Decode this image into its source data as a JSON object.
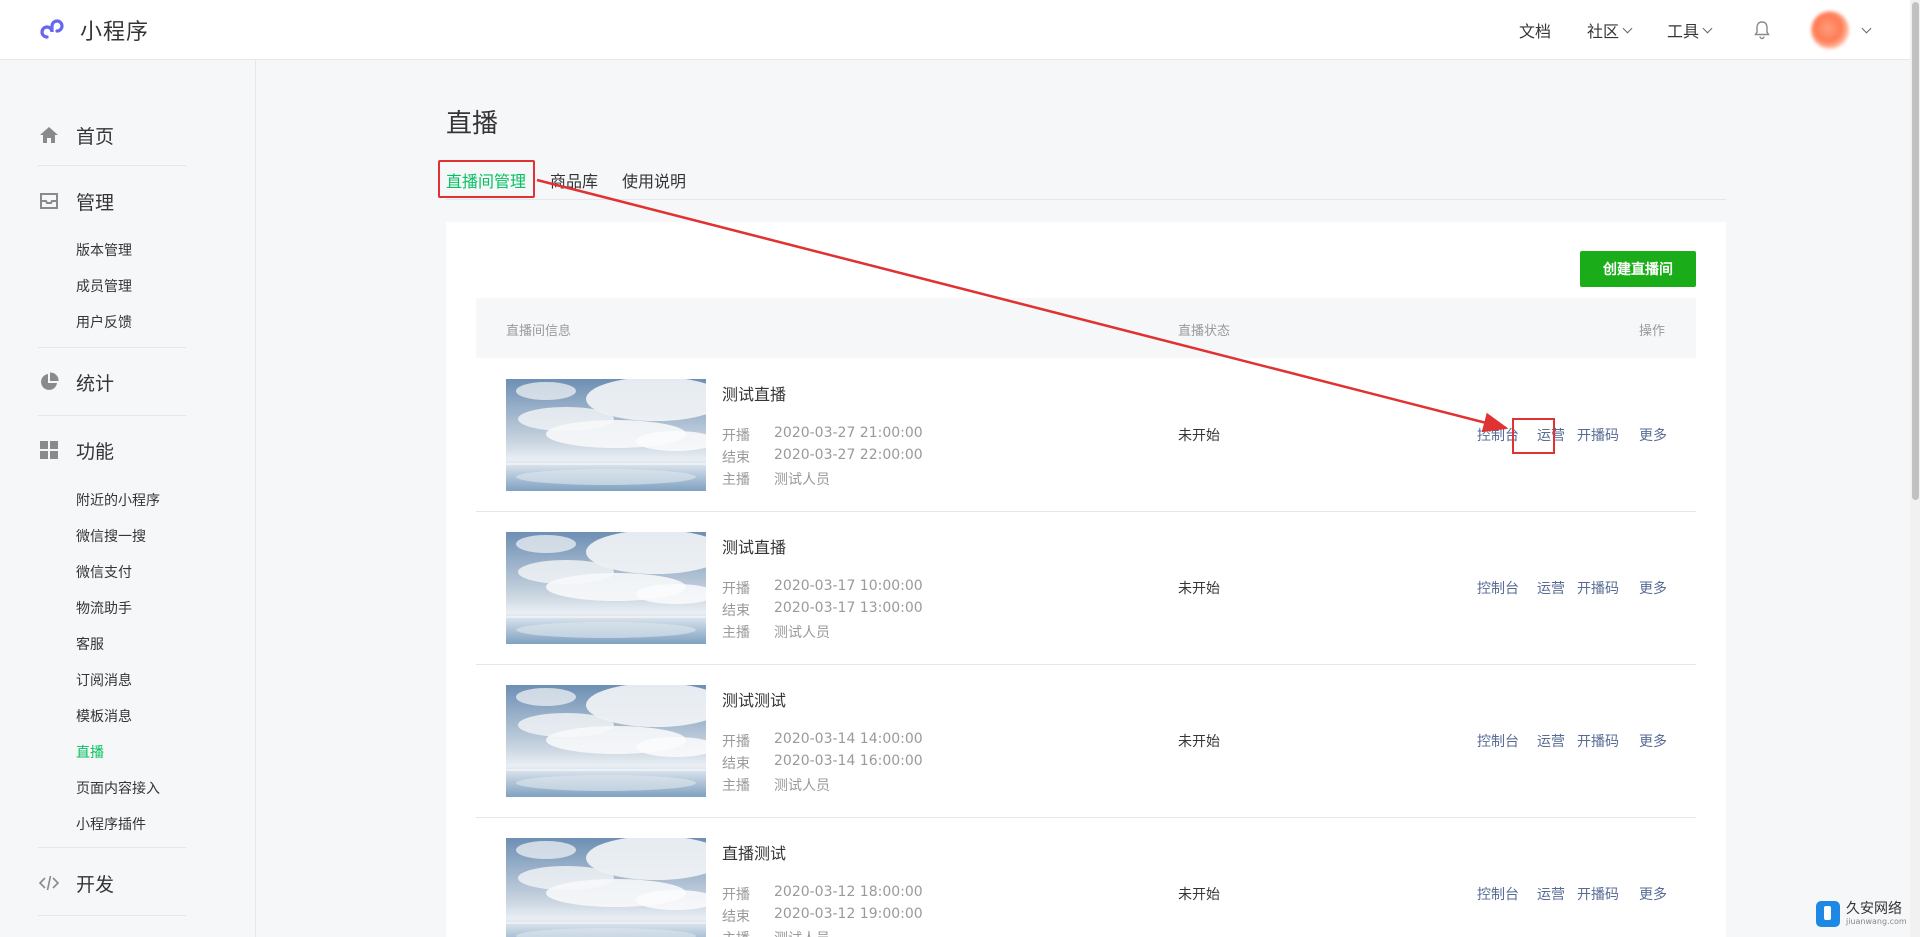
{
  "header": {
    "logo_text": "小程序",
    "nav": {
      "docs": "文档",
      "community": "社区",
      "tools": "工具"
    }
  },
  "sidebar": {
    "home": "首页",
    "manage": {
      "title": "管理",
      "items": [
        "版本管理",
        "成员管理",
        "用户反馈"
      ]
    },
    "stats": "统计",
    "features": {
      "title": "功能",
      "items": [
        "附近的小程序",
        "微信搜一搜",
        "微信支付",
        "物流助手",
        "客服",
        "订阅消息",
        "模板消息",
        "直播",
        "页面内容接入",
        "小程序插件"
      ],
      "active": "直播"
    },
    "develop": "开发"
  },
  "main": {
    "title": "直播",
    "tabs": [
      "直播间管理",
      "商品库",
      "使用说明"
    ],
    "active_tab": "直播间管理",
    "create_button": "创建直播间",
    "table_headers": {
      "info": "直播间信息",
      "status": "直播状态",
      "actions": "操作"
    },
    "meta_labels": {
      "start": "开播",
      "end": "结束",
      "anchor": "主播"
    },
    "action_labels": [
      "控制台",
      "运营",
      "开播码",
      "更多"
    ],
    "rooms": [
      {
        "title": "测试直播",
        "start": "2020-03-27 21:00:00",
        "end": "2020-03-27 22:00:00",
        "anchor": "测试人员",
        "status": "未开始"
      },
      {
        "title": "测试直播",
        "start": "2020-03-17 10:00:00",
        "end": "2020-03-17 13:00:00",
        "anchor": "测试人员",
        "status": "未开始"
      },
      {
        "title": "测试测试",
        "start": "2020-03-14 14:00:00",
        "end": "2020-03-14 16:00:00",
        "anchor": "测试人员",
        "status": "未开始"
      },
      {
        "title": "直播测试",
        "start": "2020-03-12 18:00:00",
        "end": "2020-03-12 19:00:00",
        "anchor": "测试人员",
        "status": "未开始"
      }
    ]
  },
  "watermark": {
    "main": "久安网络",
    "sub": "jiuanwang.com"
  },
  "colors": {
    "accent_green": "#07c160",
    "button_green": "#1aad19",
    "link_blue": "#576b95",
    "annotation_red": "#e03232"
  }
}
